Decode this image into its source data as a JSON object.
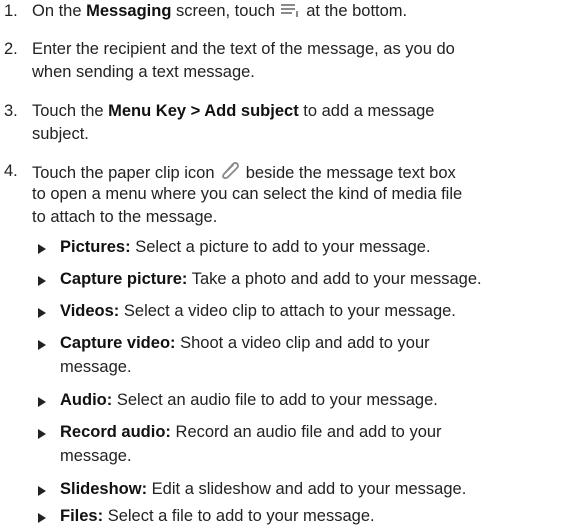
{
  "steps": [
    {
      "num": "1.",
      "pre": "On the ",
      "bold": "Messaging",
      "post1": " screen, touch ",
      "post2": " at the bottom.",
      "icon": "compose-icon"
    },
    {
      "num": "2.",
      "line1": "Enter the recipient and the text of the message, as you do",
      "line2": "when sending a text message."
    },
    {
      "num": "3.",
      "pre": "Touch the ",
      "bold": "Menu Key > Add subject",
      "post": " to add a message",
      "line2": "subject."
    },
    {
      "num": "4.",
      "line1a": "Touch the paper clip icon ",
      "line1b": " beside the message text box",
      "line2": "to open a menu where you can select the kind of media file",
      "line3": "to attach to the message.",
      "icon": "paper-clip-icon"
    }
  ],
  "bullets": [
    {
      "title": "Pictures:",
      "text": " Select a picture to add to your message."
    },
    {
      "title": "Capture picture:",
      "text": " Take a photo and add to your message."
    },
    {
      "title": "Videos:",
      "text": " Select a video clip to attach to your message."
    },
    {
      "title": "Capture video:",
      "text": " Shoot a video clip and add to your",
      "line2": "message."
    },
    {
      "title": "Audio:",
      "text": " Select an audio file to add to your message."
    },
    {
      "title": "Record audio:",
      "text": " Record an audio file and add to your",
      "line2": "message."
    },
    {
      "title": "Slideshow:",
      "text": " Edit a slideshow and add to your message."
    },
    {
      "title": "Files:",
      "text": " Select a file to add to your message."
    }
  ]
}
